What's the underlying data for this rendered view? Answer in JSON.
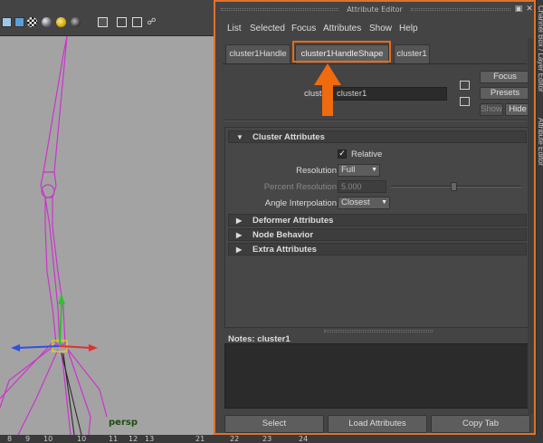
{
  "viewport": {
    "camera_label": "persp",
    "ruler_numbers": [
      "8",
      "9",
      "10",
      "10",
      "11",
      "12",
      "13",
      "21",
      "22",
      "23",
      "24"
    ]
  },
  "attribute_editor": {
    "window_title": "Attribute Editor",
    "menu": [
      "List",
      "Selected",
      "Focus",
      "Attributes",
      "Show",
      "Help"
    ],
    "tabs": [
      {
        "label": "cluster1Handle",
        "active": false
      },
      {
        "label": "cluster1HandleShape",
        "active": true
      },
      {
        "label": "cluster1",
        "active": false
      }
    ],
    "node_name_label": "clust",
    "node_name_value": "cluster1",
    "side_buttons": {
      "focus": "Focus",
      "presets": "Presets",
      "show": "Show",
      "hide": "Hide"
    },
    "sections": {
      "cluster": {
        "title": "Cluster Attributes",
        "relative_label": "Relative",
        "relative_checked": true,
        "resolution_label": "Resolution",
        "resolution_value": "Full",
        "percent_resolution_label": "Percent Resolution",
        "percent_resolution_value": "5.000",
        "angle_interpolation_label": "Angle Interpolation",
        "angle_interpolation_value": "Closest"
      },
      "collapsed": [
        "Deformer Attributes",
        "Node Behavior",
        "Extra Attributes"
      ]
    },
    "notes_label": "Notes:  cluster1",
    "bottom_buttons": {
      "select": "Select",
      "load": "Load Attributes",
      "copy": "Copy Tab"
    }
  },
  "dock_tabs": [
    "Channel Box / Layer Editor",
    "Attribute Editor"
  ],
  "colors": {
    "highlight": "#e86a1a",
    "panel_border": "#e0722a",
    "joint_color": "#cc33cc",
    "camera_label": "#1c4d12"
  }
}
